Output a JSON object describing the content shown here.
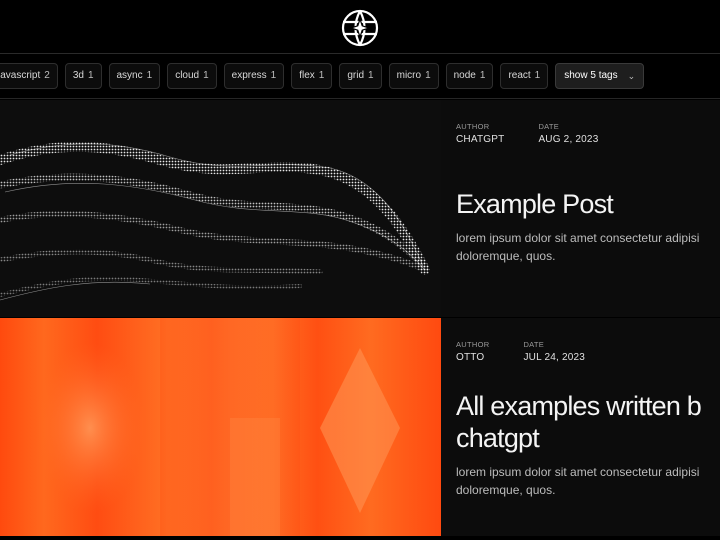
{
  "header": {
    "logo_icon": "globe-star-icon"
  },
  "tags": [
    {
      "name": "javascript",
      "count": "2"
    },
    {
      "name": "3d",
      "count": "1"
    },
    {
      "name": "async",
      "count": "1"
    },
    {
      "name": "cloud",
      "count": "1"
    },
    {
      "name": "express",
      "count": "1"
    },
    {
      "name": "flex",
      "count": "1"
    },
    {
      "name": "grid",
      "count": "1"
    },
    {
      "name": "micro",
      "count": "1"
    },
    {
      "name": "node",
      "count": "1"
    },
    {
      "name": "react",
      "count": "1"
    }
  ],
  "show_more": {
    "label": "show 5 tags",
    "icon": "chevron-down-icon"
  },
  "posts": [
    {
      "author_label": "AUTHOR",
      "author": "CHATGPT",
      "date_label": "DATE",
      "date": "AUG 2, 2023",
      "title": "Example Post",
      "excerpt_1": "lorem ipsum dolor sit amet consectetur adipisi",
      "excerpt_2": "doloremque, quos."
    },
    {
      "author_label": "AUTHOR",
      "author": "OTTO",
      "date_label": "DATE",
      "date": "JUL 24, 2023",
      "title_1": "All examples written b",
      "title_2": "chatgpt",
      "excerpt_1": "lorem ipsum dolor sit amet consectetur adipisi",
      "excerpt_2": "doloremque, quos."
    }
  ],
  "colors": {
    "accent_orange": "#ff5a14",
    "background": "#000000"
  }
}
